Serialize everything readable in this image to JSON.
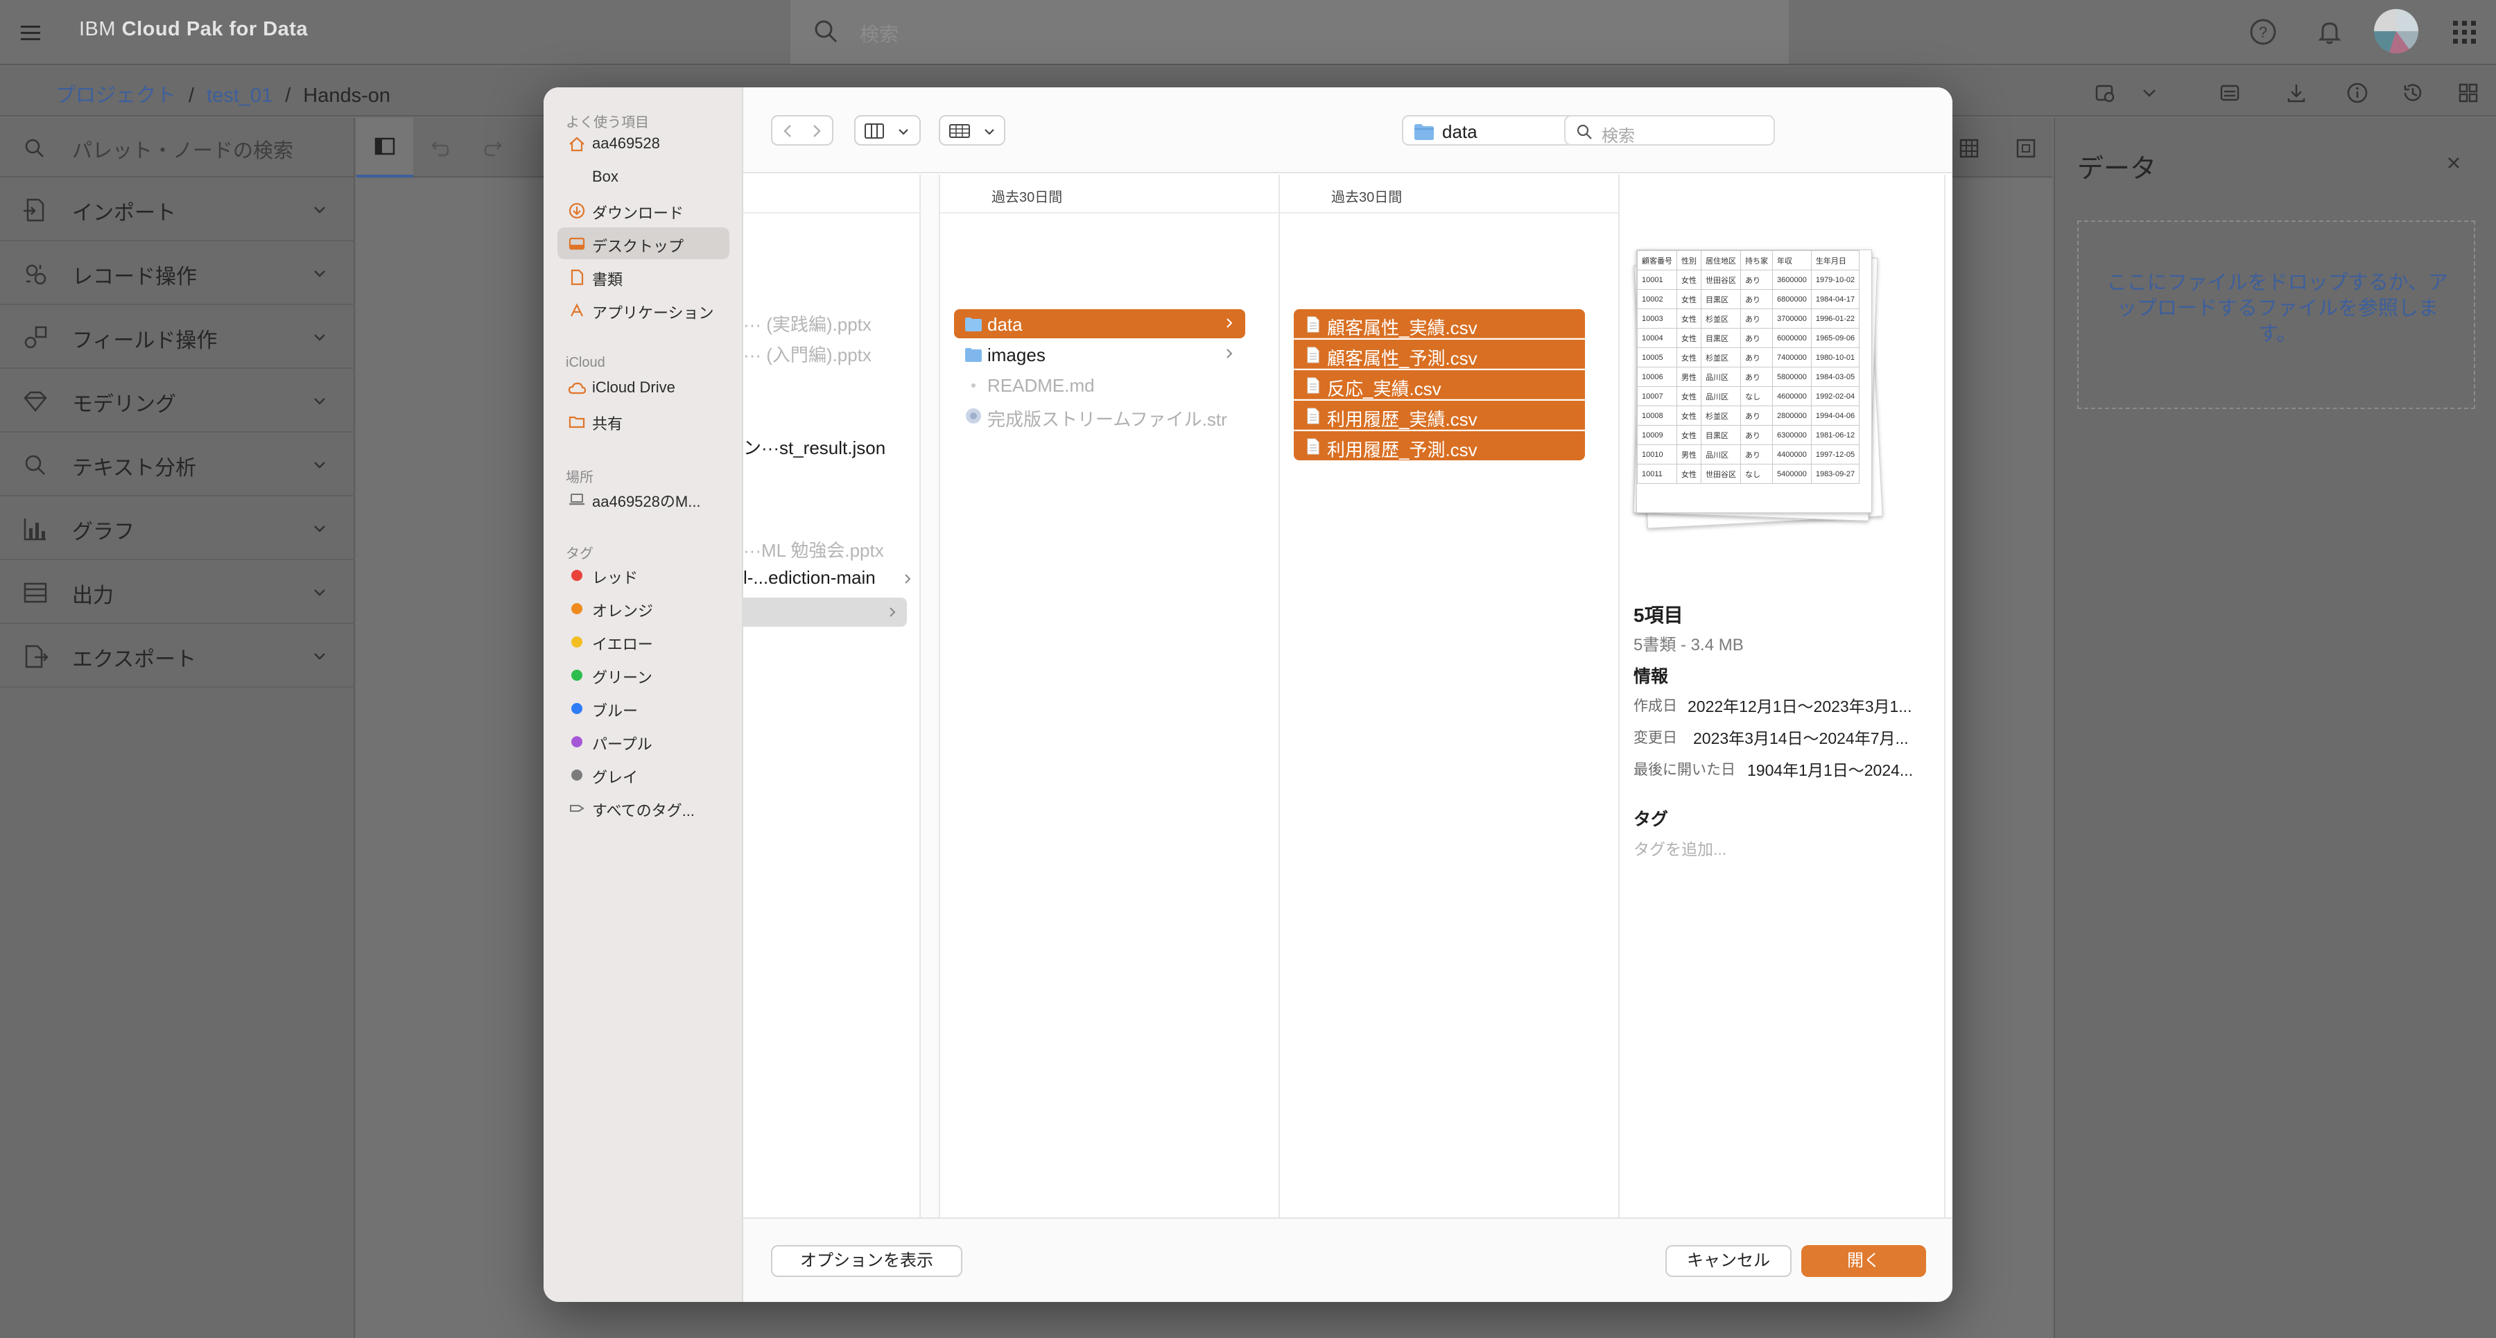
{
  "app": {
    "brand_light": "IBM ",
    "brand_bold": "Cloud Pak for Data",
    "search_placeholder": "検索"
  },
  "breadcrumb": {
    "project": "プロジェクト",
    "name": "test_01",
    "current": "Hands-on",
    "separator": "/"
  },
  "palette": {
    "search_placeholder": "パレット・ノードの検索",
    "categories": [
      "インポート",
      "レコード操作",
      "フィールド操作",
      "モデリング",
      "テキスト分析",
      "グラフ",
      "出力",
      "エクスポート"
    ]
  },
  "data_panel": {
    "title": "データ",
    "drop_text": "ここにファイルをドロップするか、アップロードするファイルを参照します。"
  },
  "dialog": {
    "sidebar": {
      "favorites_heading": "よく使う項目",
      "favorites": [
        "aa469528",
        "Box",
        "ダウンロード",
        "デスクトップ",
        "書類",
        "アプリケーション"
      ],
      "icloud_heading": "iCloud",
      "icloud": [
        "iCloud Drive",
        "共有"
      ],
      "locations_heading": "場所",
      "locations": [
        "aa469528のM..."
      ],
      "tags_heading": "タグ",
      "tags": [
        {
          "label": "レッド",
          "color": "#e8423a"
        },
        {
          "label": "オレンジ",
          "color": "#ef8a1f"
        },
        {
          "label": "イエロー",
          "color": "#f2be22"
        },
        {
          "label": "グリーン",
          "color": "#2dbd4e"
        },
        {
          "label": "ブルー",
          "color": "#2f7df6"
        },
        {
          "label": "パープル",
          "color": "#a557d8"
        },
        {
          "label": "グレイ",
          "color": "#7c7c7c"
        }
      ],
      "all_tags": "すべてのタグ..."
    },
    "path": "data",
    "search_placeholder": "検索",
    "col1": {
      "items": [
        "··· (実践編).pptx",
        "··· (入門編).pptx",
        "ン···st_result.json",
        "···ML 勉強会.pptx",
        "l-...ediction-main"
      ]
    },
    "col2": {
      "header": "過去30日間",
      "items": [
        "data",
        "images",
        "README.md",
        "完成版ストリームファイル.str"
      ]
    },
    "col3": {
      "header": "過去30日間",
      "items": [
        "顧客属性_実績.csv",
        "顧客属性_予測.csv",
        "反応_実績.csv",
        "利用履歴_実績.csv",
        "利用履歴_予測.csv"
      ]
    },
    "preview": {
      "headers": [
        "顧客番号",
        "性別",
        "居住地区",
        "持ち家",
        "年収",
        "生年月日"
      ],
      "rows": [
        [
          "10001",
          "女性",
          "世田谷区",
          "あり",
          "3600000",
          "1979-10-02"
        ],
        [
          "10002",
          "女性",
          "目黒区",
          "あり",
          "6800000",
          "1984-04-17"
        ],
        [
          "10003",
          "女性",
          "杉並区",
          "あり",
          "3700000",
          "1996-01-22"
        ],
        [
          "10004",
          "女性",
          "目黒区",
          "あり",
          "6000000",
          "1965-09-06"
        ],
        [
          "10005",
          "女性",
          "杉並区",
          "あり",
          "7400000",
          "1980-10-01"
        ],
        [
          "10006",
          "男性",
          "品川区",
          "あり",
          "5800000",
          "1984-03-05"
        ],
        [
          "10007",
          "女性",
          "品川区",
          "なし",
          "4600000",
          "1992-02-04"
        ],
        [
          "10008",
          "女性",
          "杉並区",
          "あり",
          "2800000",
          "1994-04-06"
        ],
        [
          "10009",
          "女性",
          "目黒区",
          "あり",
          "6300000",
          "1981-06-12"
        ],
        [
          "10010",
          "男性",
          "品川区",
          "あり",
          "4400000",
          "1997-12-05"
        ],
        [
          "10011",
          "女性",
          "世田谷区",
          "なし",
          "5400000",
          "1983-09-27"
        ]
      ],
      "title": "5項目",
      "subtitle": "5書類 - 3.4 MB",
      "info_heading": "情報",
      "created_label": "作成日",
      "created_value": "2022年12月1日〜2023年3月1...",
      "modified_label": "変更日",
      "modified_value": "2023年3月14日〜2024年7月...",
      "opened_label": "最後に開いた日",
      "opened_value": "1904年1月1日〜2024...",
      "tags_heading": "タグ",
      "tags_placeholder": "タグを追加..."
    },
    "options_button": "オプションを表示",
    "cancel_button": "キャンセル",
    "open_button": "開く"
  }
}
